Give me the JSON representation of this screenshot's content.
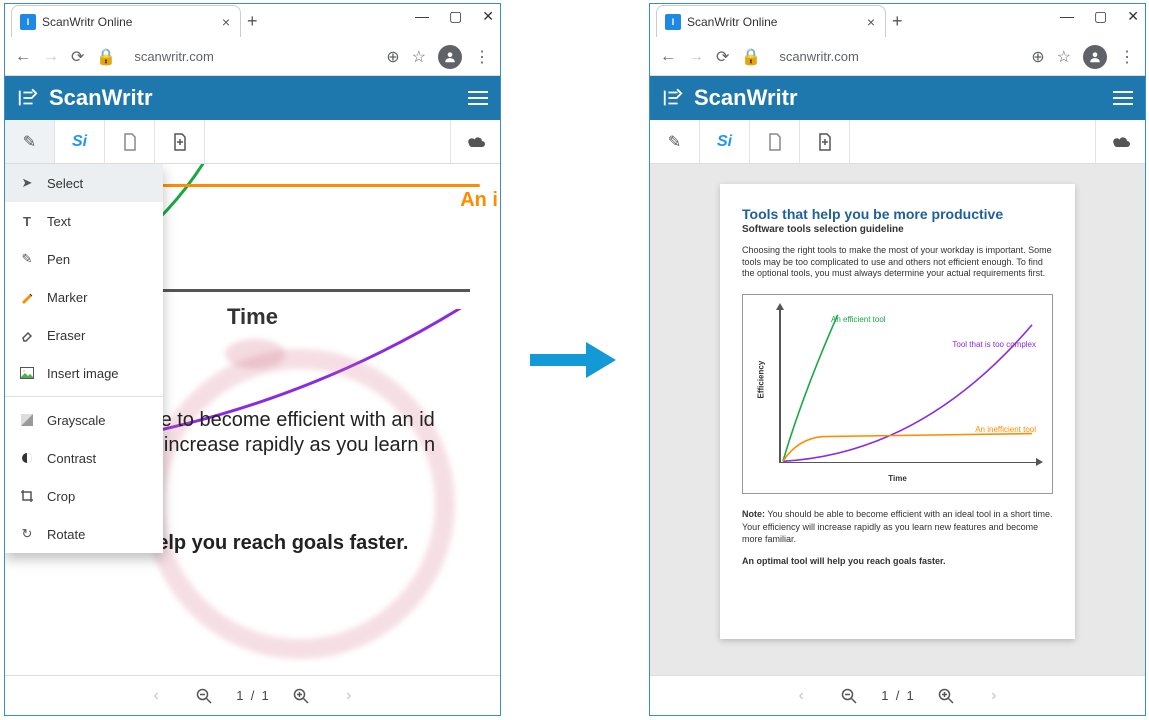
{
  "browser": {
    "tab_title": "ScanWritr Online",
    "url": "scanwritr.com"
  },
  "app": {
    "name": "ScanWritr"
  },
  "dropdown": {
    "select": "Select",
    "text": "Text",
    "pen": "Pen",
    "marker": "Marker",
    "eraser": "Eraser",
    "insert_image": "Insert image",
    "grayscale": "Grayscale",
    "contrast": "Contrast",
    "crop": "Crop",
    "rotate": "Rotate"
  },
  "footer": {
    "page_current": "1",
    "page_sep": "/",
    "page_total": "1"
  },
  "doc_fragment": {
    "time_label": "Time",
    "label_ineff": "An i",
    "line1": "ble to become efficient with an id",
    "line2": "ill increase rapidly as you learn n",
    "line3": "help you reach goals faster."
  },
  "document": {
    "title": "Tools that help you be more productive",
    "subtitle": "Software tools selection guideline",
    "para": "Choosing the right tools to make the most of your workday is important. Some tools may be too complicated to use and others not efficient enough. To find the optional tools, you must always determine your actual requirements first.",
    "note_label": "Note:",
    "note_rest": " You should be able to become efficient with an ideal tool in a short time. Your efficiency will increase rapidly as you learn new features and become more familiar.",
    "final": "An optimal tool will help you reach goals faster."
  },
  "chart_data": {
    "type": "line",
    "xlabel": "Time",
    "ylabel": "Efficiency",
    "xlim": [
      0,
      10
    ],
    "ylim": [
      0,
      10
    ],
    "series": [
      {
        "name": "An efficient tool",
        "color": "#1aa845",
        "x": [
          0,
          1,
          2,
          3,
          4,
          5
        ],
        "y": [
          0,
          1,
          2.5,
          5,
          8,
          10
        ]
      },
      {
        "name": "Tool that is too complex",
        "color": "#8a2be2",
        "x": [
          0,
          2,
          4,
          6,
          8,
          9,
          10
        ],
        "y": [
          0,
          0.5,
          1,
          2.5,
          5,
          7.5,
          10
        ]
      },
      {
        "name": "An inefficient tool",
        "color": "#ff8c00",
        "x": [
          0,
          1,
          2,
          10
        ],
        "y": [
          0,
          1.2,
          1.5,
          1.6
        ]
      }
    ]
  }
}
